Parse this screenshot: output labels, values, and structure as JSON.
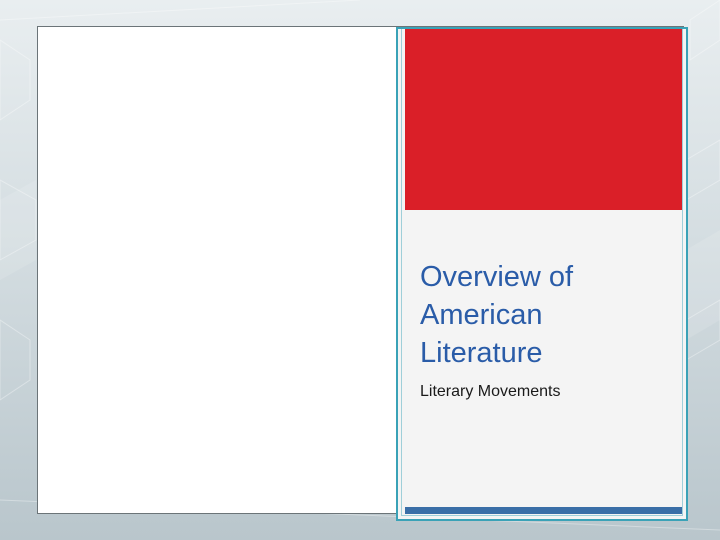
{
  "slide": {
    "title": "Overview of American Literature",
    "subtitle": "Literary Movements"
  },
  "colors": {
    "accent_red": "#da1f28",
    "frame_teal": "#3aa2b7",
    "bar_blue": "#3a6ea7",
    "title_blue": "#2a5ca8",
    "card_bg": "#f4f4f4"
  }
}
